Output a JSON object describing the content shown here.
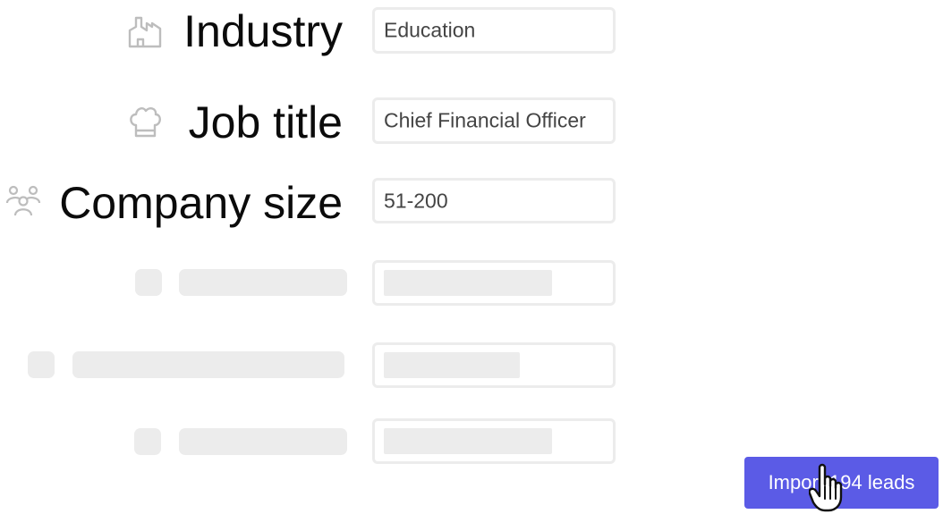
{
  "fields": [
    {
      "label": "Industry",
      "value": "Education",
      "icon": "factory-icon"
    },
    {
      "label": "Job title",
      "value": "Chief Financial Officer",
      "icon": "chef-hat-icon"
    },
    {
      "label": "Company size",
      "value": "51-200",
      "icon": "team-icon"
    }
  ],
  "import_button": {
    "label": "Import 194 leads"
  },
  "colors": {
    "accent": "#5b5be6",
    "skeleton": "#ececec",
    "icon": "#bdbdbd"
  }
}
